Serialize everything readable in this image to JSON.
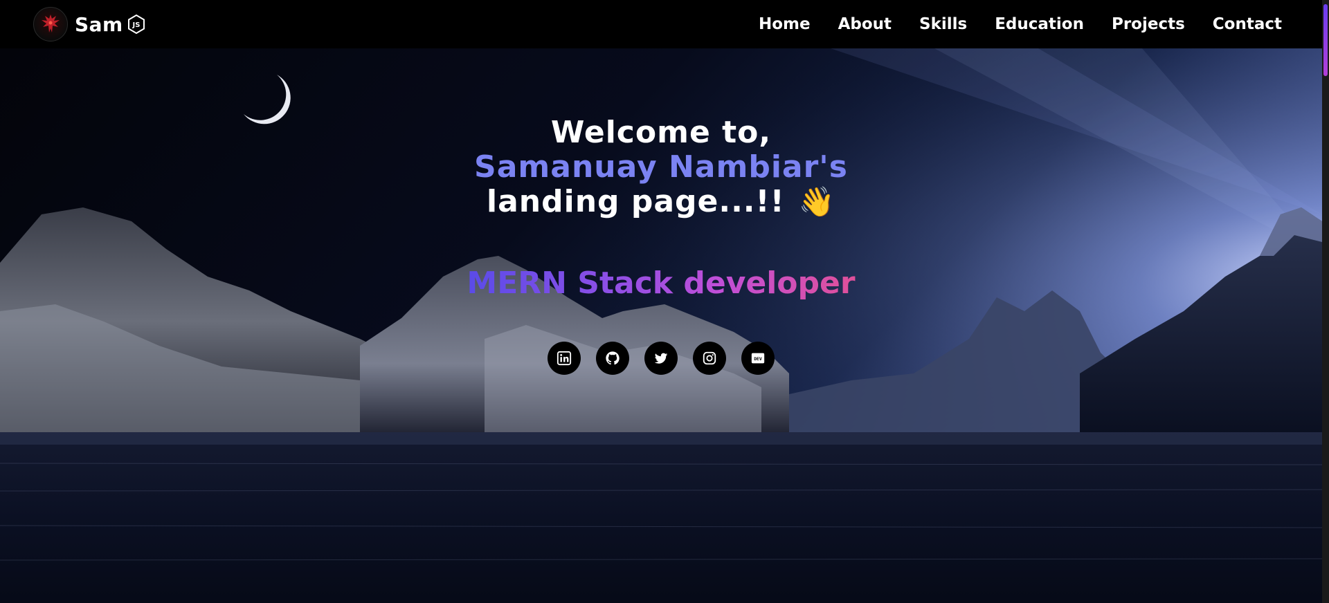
{
  "brand": {
    "name": "Sam",
    "js_label": "JS"
  },
  "nav": {
    "items": [
      {
        "label": "Home"
      },
      {
        "label": "About"
      },
      {
        "label": "Skills"
      },
      {
        "label": "Education"
      },
      {
        "label": "Projects"
      },
      {
        "label": "Contact"
      }
    ]
  },
  "hero": {
    "line1": "Welcome to,",
    "line2": "Samanuay Nambiar's",
    "line3": "landing page...!!",
    "wave_emoji": "👋",
    "role": "MERN Stack developer",
    "socials": [
      {
        "icon": "linkedin-icon"
      },
      {
        "icon": "github-icon"
      },
      {
        "icon": "twitter-icon"
      },
      {
        "icon": "instagram-icon"
      },
      {
        "icon": "dev-icon"
      }
    ]
  },
  "colors": {
    "background": "#000000",
    "name_accent": "#7b83f2",
    "role_gradient_start": "#5a4be8",
    "role_gradient_end": "#e0509a",
    "scroll_thumb": "#8a3fe6"
  }
}
